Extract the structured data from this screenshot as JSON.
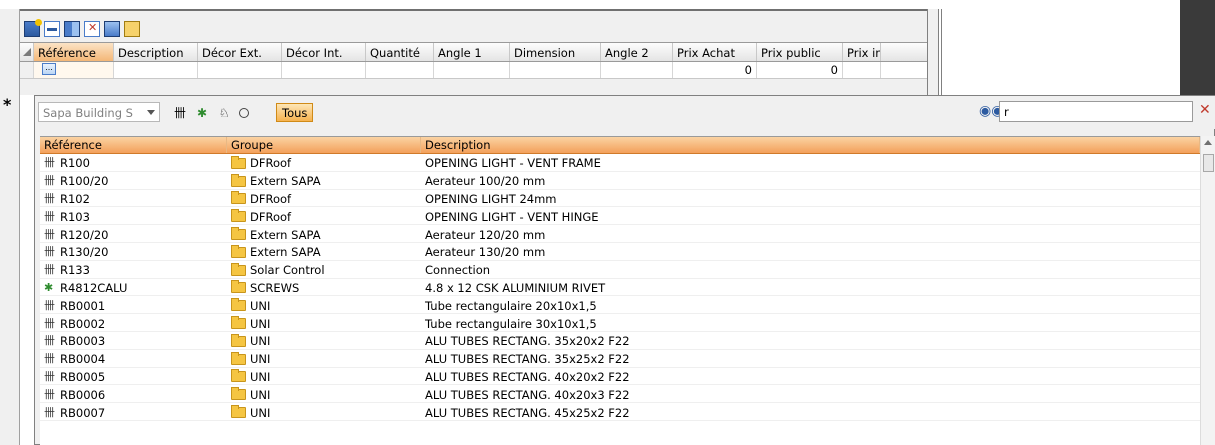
{
  "upper_grid": {
    "columns": [
      "Référence",
      "Description",
      "Décor Ext.",
      "Décor Int.",
      "Quantité",
      "Angle 1",
      "Dimension",
      "Angle 2",
      "Prix Achat",
      "Prix public",
      "Prix imp"
    ],
    "row": {
      "ellipsis": "...",
      "prix_achat": "0",
      "prix_public": "0"
    },
    "new_row_marker": "*"
  },
  "lookup": {
    "source_combo": "Sapa Building S",
    "tous_label": "Tous",
    "search_value": "r",
    "columns": [
      "Référence",
      "Groupe",
      "Description"
    ],
    "rows": [
      {
        "ref": "R100",
        "group": "DFRoof",
        "desc": "OPENING LIGHT - VENT FRAME",
        "icon": "profile-icon"
      },
      {
        "ref": "R100/20",
        "group": "Extern SAPA",
        "desc": "Aerateur 100/20 mm",
        "icon": "profile-icon"
      },
      {
        "ref": "R102",
        "group": "DFRoof",
        "desc": "OPENING LIGHT 24mm",
        "icon": "profile-icon"
      },
      {
        "ref": "R103",
        "group": "DFRoof",
        "desc": "OPENING LIGHT - VENT HINGE",
        "icon": "profile-icon"
      },
      {
        "ref": "R120/20",
        "group": "Extern SAPA",
        "desc": "Aerateur 120/20 mm",
        "icon": "profile-icon"
      },
      {
        "ref": "R130/20",
        "group": "Extern SAPA",
        "desc": "Aerateur 130/20 mm",
        "icon": "profile-icon"
      },
      {
        "ref": "R133",
        "group": "Solar Control",
        "desc": "Connection",
        "icon": "profile-icon"
      },
      {
        "ref": "R4812CALU",
        "group": "SCREWS",
        "desc": "4.8 x 12 CSK ALUMINIUM RIVET",
        "icon": "accessory-icon"
      },
      {
        "ref": "RB0001",
        "group": "UNI",
        "desc": "Tube rectangulaire 20x10x1,5",
        "icon": "profile-icon"
      },
      {
        "ref": "RB0002",
        "group": "UNI",
        "desc": "Tube rectangulaire 30x10x1,5",
        "icon": "profile-icon"
      },
      {
        "ref": "RB0003",
        "group": "UNI",
        "desc": "ALU TUBES RECTANG. 35x20x2 F22",
        "icon": "profile-icon"
      },
      {
        "ref": "RB0004",
        "group": "UNI",
        "desc": "ALU TUBES RECTANG. 35x25x2 F22",
        "icon": "profile-icon"
      },
      {
        "ref": "RB0005",
        "group": "UNI",
        "desc": "ALU TUBES RECTANG. 40x20x2 F22",
        "icon": "profile-icon"
      },
      {
        "ref": "RB0006",
        "group": "UNI",
        "desc": "ALU TUBES RECTANG. 40x20x3 F22",
        "icon": "profile-icon"
      },
      {
        "ref": "RB0007",
        "group": "UNI",
        "desc": "ALU TUBES RECTANG. 45x25x2 F22",
        "icon": "profile-icon"
      }
    ]
  },
  "colors": {
    "header_orange": "#f3a05b",
    "tous_orange": "#f6b24f",
    "folder_yellow": "#f5c542"
  }
}
